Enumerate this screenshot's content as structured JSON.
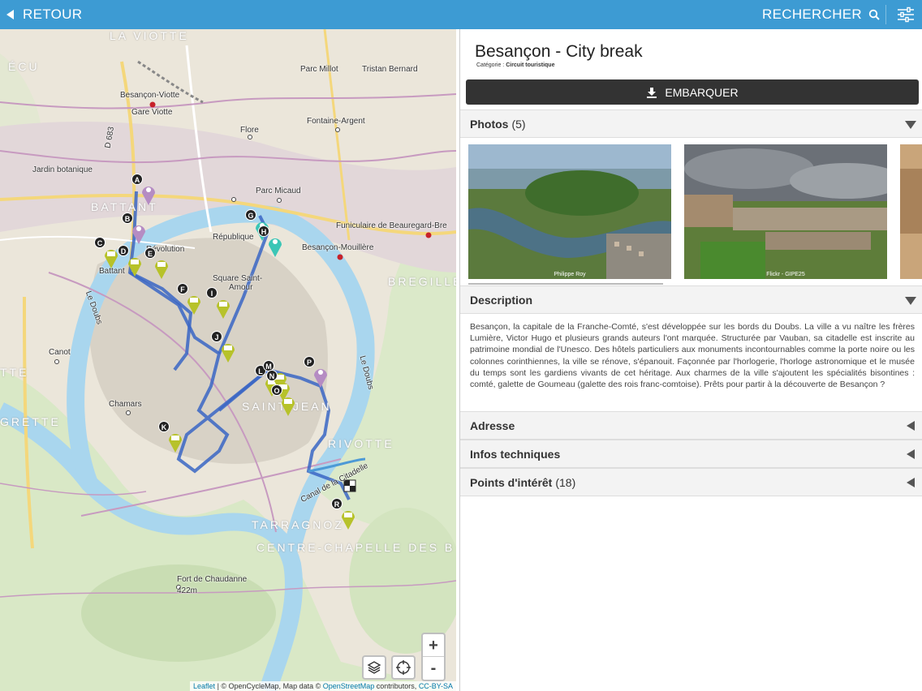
{
  "topbar": {
    "back_label": "RETOUR",
    "search_label": "RECHERCHER",
    "accent": "#3d9bd3"
  },
  "map": {
    "labels": {
      "la_viotte": "LA VIOTTE",
      "ecu": "ÉCU",
      "parc_millot": "Parc Millot",
      "tristan_bernard": "Tristan Bernard",
      "besancon_viotte": "Besançon-Viotte",
      "gare_viotte": "Gare Viotte",
      "fontaine_argent": "Fontaine-Argent",
      "flore": "Flore",
      "jardin_botanique": "Jardin botanique",
      "parc_micaud": "Parc Micaud",
      "battant_big": "BATTANT",
      "republique": "République",
      "funiculaire": "Funiculaire de Beauregard-Bre",
      "besancon_mouillere": "Besançon-Mouillère",
      "revolution": "Révolution",
      "battant": "Battant",
      "square_saint": "Square Saint-",
      "amour": "Amour",
      "bregille": "BREGILLE",
      "canot": "Canot",
      "le_doubs": "Le Doubs",
      "chamars": "Chamars",
      "saint_jean": "SAINT JEAN",
      "rivotte": "RIVOTTE",
      "tte": "TTE",
      "grette": "GRETTE",
      "tarragnoz": "TARRAGNOZ",
      "centre_chapelle": "CENTRE-CHAPELLE DES B",
      "fort_chaudanne": "Fort de Chaudanne",
      "alt_422": "422m",
      "canal": "Canal de la Citadelle",
      "d683": "D 683"
    },
    "markers": [
      "A",
      "B",
      "C",
      "D",
      "E",
      "F",
      "G",
      "H",
      "I",
      "J",
      "K",
      "L",
      "M",
      "N",
      "O",
      "P",
      "R"
    ],
    "zoom_in": "+",
    "zoom_out": "-",
    "attribution": {
      "leaflet": "Leaflet",
      "text1": " | © OpenCycleMap, Map data © ",
      "osm": "OpenStreetMap",
      "text2": " contributors, ",
      "license": "CC-BY-SA"
    }
  },
  "panel": {
    "title": "Besançon - City break",
    "category_label": "Catégorie : ",
    "category_value": "Circuit touristique",
    "embark_label": "EMBARQUER",
    "photos_label": "Photos",
    "photos_count": "(5)",
    "photo_captions": [
      "Philippe Roy",
      "Flickr - GIPE25"
    ],
    "description_label": "Description",
    "description_text": "Besançon, la capitale de la Franche-Comté, s'est développée sur les bords du Doubs. La ville a vu naître les frères Lumière, Victor Hugo et plusieurs grands auteurs l'ont marquée. Structurée par Vauban, sa citadelle est inscrite au patrimoine mondial de l'Unesco. Des hôtels particuliers aux monuments incontournables comme la porte noire ou les colonnes corinthiennes, la ville se rénove, s'épanouit. Façonnée par l'horlogerie, l'horloge astronomique et le musée du temps sont les gardiens vivants de cet héritage. Aux charmes de la ville s'ajoutent les spécialités bisontines : comté, galette de Goumeau (galette des rois franc-comtoise). Prêts pour partir à la découverte de Besançon ?",
    "address_label": "Adresse",
    "tech_label": "Infos techniques",
    "poi_label": "Points d'intérêt",
    "poi_count": "(18)"
  }
}
